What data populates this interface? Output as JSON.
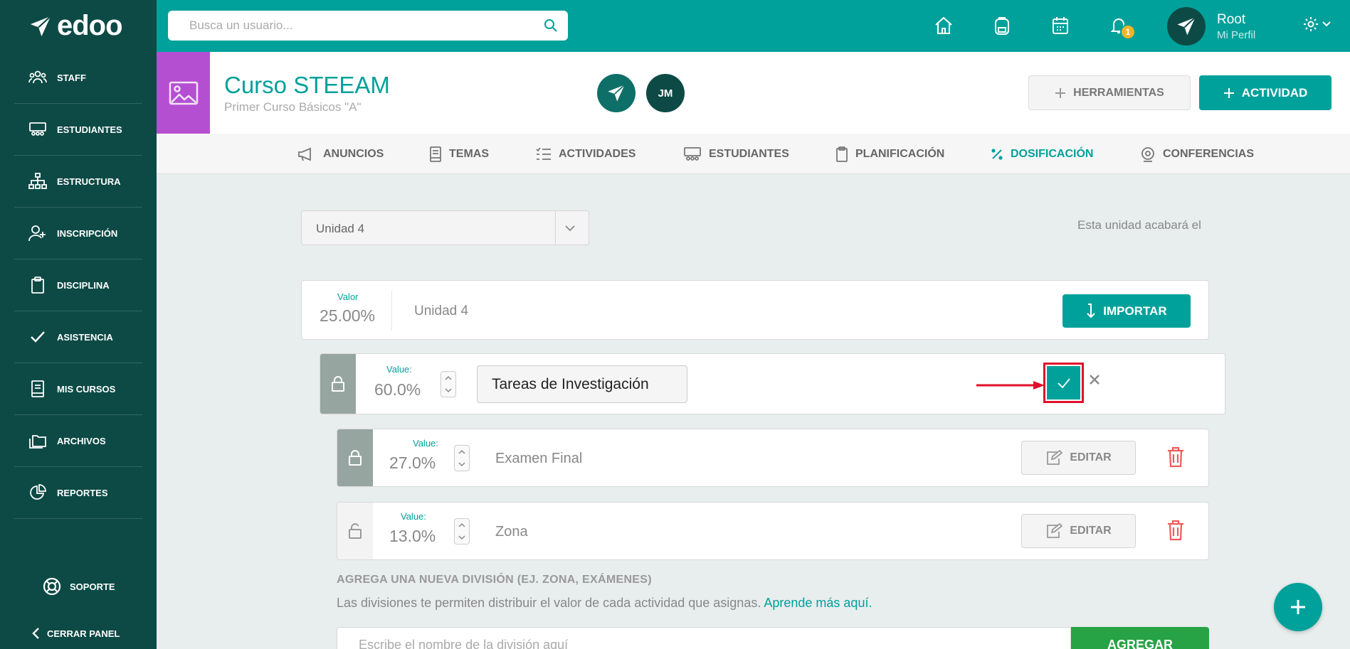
{
  "app": {
    "logo_text": "edoo"
  },
  "sidebar": {
    "items": [
      {
        "label": "STAFF",
        "icon": "staff-icon"
      },
      {
        "label": "ESTUDIANTES",
        "icon": "students-icon"
      },
      {
        "label": "ESTRUCTURA",
        "icon": "structure-icon"
      },
      {
        "label": "INSCRIPCIÓN",
        "icon": "enrollment-icon"
      },
      {
        "label": "DISCIPLINA",
        "icon": "clipboard-icon"
      },
      {
        "label": "ASISTENCIA",
        "icon": "check-icon"
      },
      {
        "label": "MIS CURSOS",
        "icon": "book-icon"
      },
      {
        "label": "ARCHIVOS",
        "icon": "folders-icon"
      },
      {
        "label": "REPORTES",
        "icon": "pie-chart-icon"
      }
    ],
    "support_label": "SOPORTE",
    "collapse_label": "CERRAR PANEL"
  },
  "topbar": {
    "search_placeholder": "Busca un usuario...",
    "notification_count": "1",
    "profile_name": "Root",
    "profile_sub": "Mi Perfil"
  },
  "course": {
    "title": "Curso STEEAM",
    "subtitle": "Primer Curso Básicos \"A\"",
    "teacher_initials": "JM",
    "tools_label": "HERRAMIENTAS",
    "activity_label": "ACTIVIDAD"
  },
  "tabs": [
    {
      "label": "ANUNCIOS",
      "icon": "megaphone-icon"
    },
    {
      "label": "TEMAS",
      "icon": "book-icon"
    },
    {
      "label": "ACTIVIDADES",
      "icon": "list-icon"
    },
    {
      "label": "ESTUDIANTES",
      "icon": "students-icon"
    },
    {
      "label": "PLANIFICACIÓN",
      "icon": "clipboard-icon"
    },
    {
      "label": "DOSIFICACIÓN",
      "icon": "percent-icon",
      "active": true
    },
    {
      "label": "CONFERENCIAS",
      "icon": "webcam-icon"
    }
  ],
  "main": {
    "unit_select_value": "Unidad 4",
    "unit_end_text": "Esta unidad acabará el",
    "unit": {
      "value_label": "Valor",
      "value": "25.00%",
      "name": "Unidad 4",
      "import_label": "IMPORTAR"
    },
    "editing_division": {
      "value_label": "Value:",
      "value": "60.0%",
      "name_value": "Tareas de Investigación"
    },
    "divisions": [
      {
        "value_label": "Value:",
        "value": "27.0%",
        "name": "Examen Final",
        "locked": true,
        "edit_label": "EDITAR"
      },
      {
        "value_label": "Value:",
        "value": "13.0%",
        "name": "Zona",
        "locked": false,
        "edit_label": "EDITAR"
      }
    ],
    "add_section": {
      "title": "AGREGA UNA NUEVA DIVISIÓN (EJ. ZONA, EXÁMENES)",
      "description": "Las divisiones te permiten distribuir el valor de cada actividad que asignas.",
      "learn_more": "Aprende más aquí.",
      "input_placeholder": "Escribe el nombre de la división aquí",
      "add_label": "AGREGAR"
    }
  },
  "colors": {
    "sidebar": "#0d4a45",
    "accent": "#00a19b",
    "course_image": "#b54fd2",
    "highlight": "#e0102a",
    "add_button": "#27a345",
    "badge": "#f0b429"
  }
}
